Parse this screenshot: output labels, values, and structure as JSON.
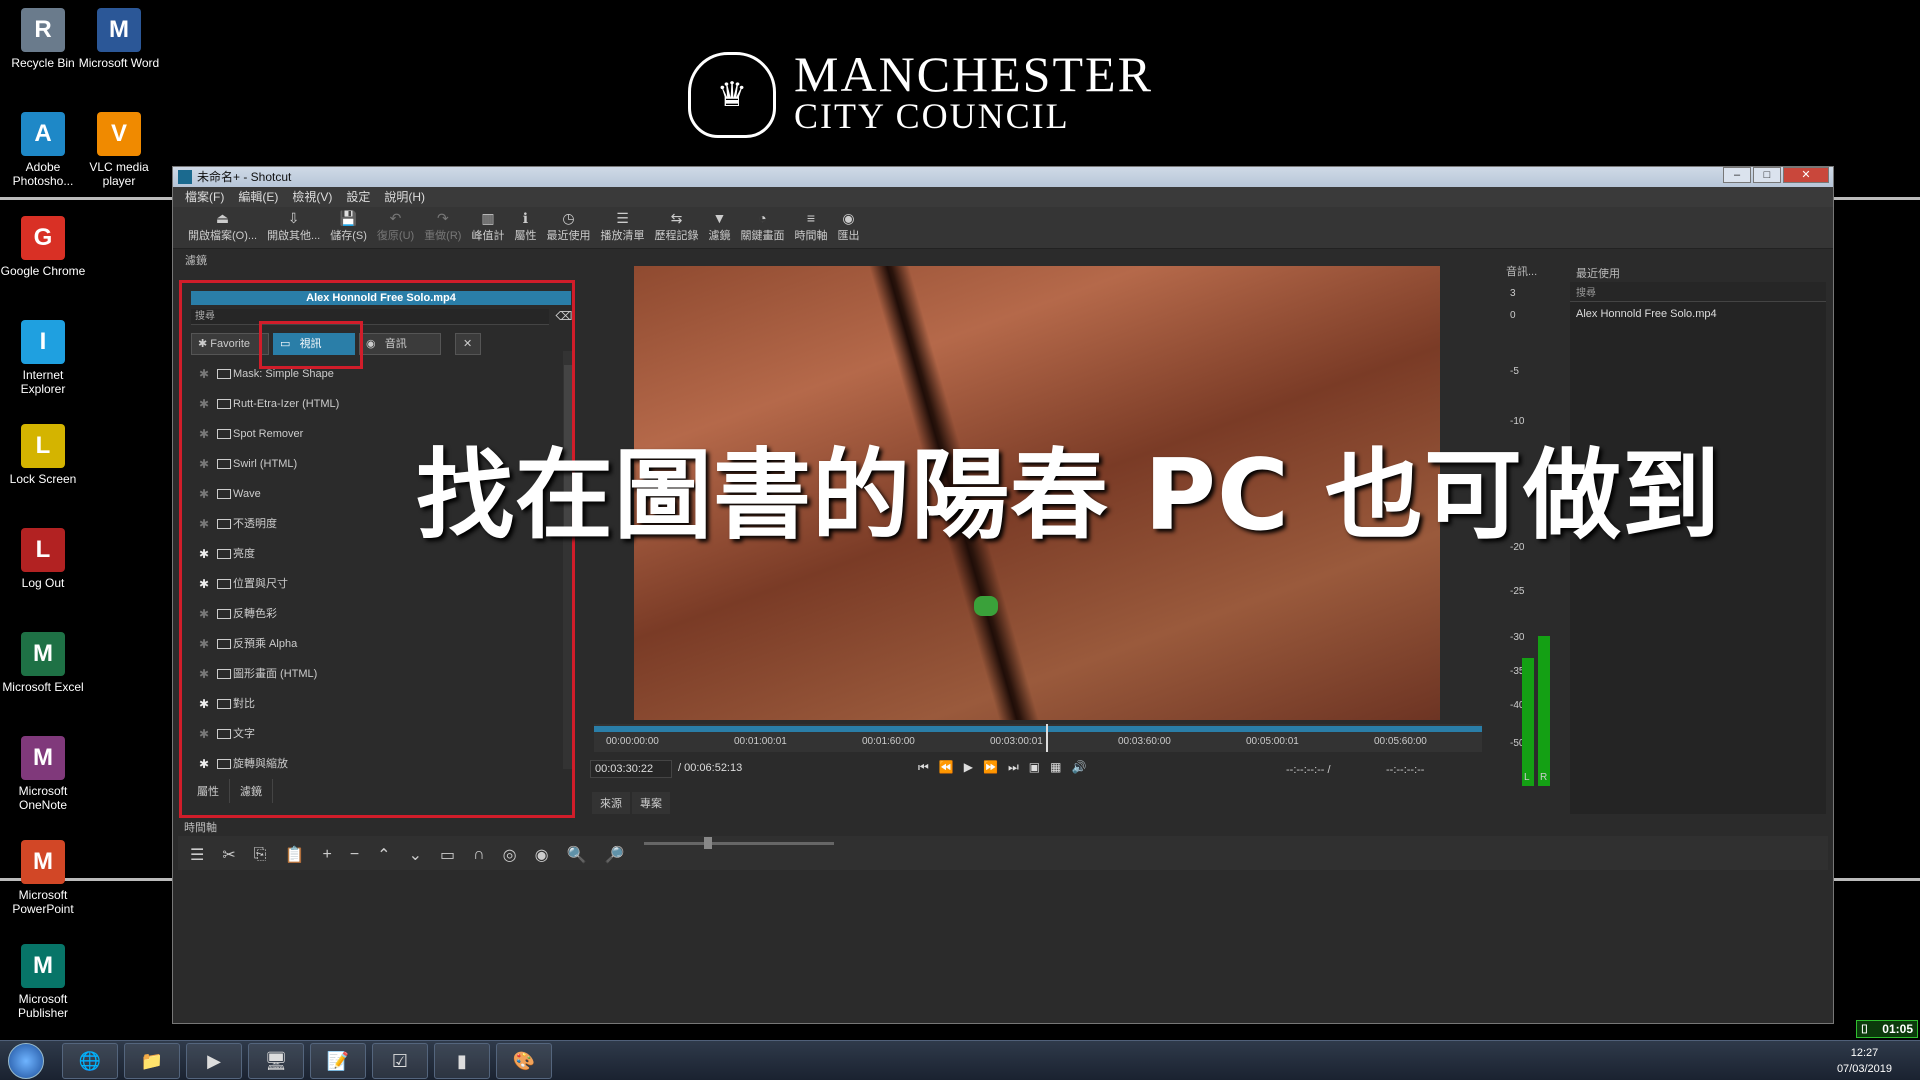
{
  "desktop": {
    "icons": [
      {
        "label": "Recycle Bin",
        "icon": "recycle-bin-icon",
        "color": "#6a7b8c"
      },
      {
        "label": "Microsoft Word",
        "icon": "word-icon",
        "color": "#2b5797"
      },
      {
        "label": "Adobe Photosho...",
        "icon": "photoshop-icon",
        "color": "#1e88c7"
      },
      {
        "label": "VLC media player",
        "icon": "vlc-icon",
        "color": "#f08a00"
      },
      {
        "label": "Google Chrome",
        "icon": "chrome-icon",
        "color": "#d93025"
      },
      {
        "label": "Internet Explorer",
        "icon": "ie-icon",
        "color": "#1fa0e0"
      },
      {
        "label": "Lock Screen",
        "icon": "lock-icon",
        "color": "#d4b400"
      },
      {
        "label": "Log Out",
        "icon": "logout-icon",
        "color": "#b22222"
      },
      {
        "label": "Microsoft Excel",
        "icon": "excel-icon",
        "color": "#1e7145"
      },
      {
        "label": "Microsoft OneNote",
        "icon": "onenote-icon",
        "color": "#80397b"
      },
      {
        "label": "Microsoft PowerPoint",
        "icon": "powerpoint-icon",
        "color": "#d24726"
      },
      {
        "label": "Microsoft Publisher",
        "icon": "publisher-icon",
        "color": "#077568"
      }
    ]
  },
  "logo": {
    "line1": "MANCHESTER",
    "line2": "CITY COUNCIL"
  },
  "window": {
    "title": "未命名+ - Shotcut",
    "menu": [
      "檔案(F)",
      "編輯(E)",
      "檢視(V)",
      "設定",
      "說明(H)"
    ],
    "toolbar": [
      {
        "label": "開啟檔案(O)...",
        "glyph": "⏏",
        "enabled": true
      },
      {
        "label": "開啟其他...",
        "glyph": "⇩",
        "enabled": true
      },
      {
        "label": "儲存(S)",
        "glyph": "💾",
        "enabled": true
      },
      {
        "label": "復原(U)",
        "glyph": "↶",
        "enabled": false
      },
      {
        "label": "重做(R)",
        "glyph": "↷",
        "enabled": false
      },
      {
        "label": "峰值計",
        "glyph": "▥",
        "enabled": true
      },
      {
        "label": "屬性",
        "glyph": "ℹ",
        "enabled": true
      },
      {
        "label": "最近使用",
        "glyph": "◷",
        "enabled": true
      },
      {
        "label": "播放清單",
        "glyph": "☰",
        "enabled": true
      },
      {
        "label": "歷程記錄",
        "glyph": "⇆",
        "enabled": true
      },
      {
        "label": "濾鏡",
        "glyph": "▼",
        "enabled": true
      },
      {
        "label": "關鍵畫面",
        "glyph": "◔",
        "enabled": true
      },
      {
        "label": "時間軸",
        "glyph": "≡",
        "enabled": true
      },
      {
        "label": "匯出",
        "glyph": "◉",
        "enabled": true
      }
    ]
  },
  "filters": {
    "panel_title": "濾鏡",
    "clip_name": "Alex Honnold Free Solo.mp4",
    "search_placeholder": "搜尋",
    "tab_favorite": "Favorite",
    "tab_video": "視訊",
    "tab_audio": "音訊",
    "items": [
      {
        "label": "Mask: Simple Shape",
        "fav": false
      },
      {
        "label": "Rutt-Etra-Izer (HTML)",
        "fav": false
      },
      {
        "label": "Spot Remover",
        "fav": false
      },
      {
        "label": "Swirl (HTML)",
        "fav": false
      },
      {
        "label": "Wave",
        "fav": false
      },
      {
        "label": "不透明度",
        "fav": false
      },
      {
        "label": "亮度",
        "fav": true
      },
      {
        "label": "位置與尺寸",
        "fav": true
      },
      {
        "label": "反轉色彩",
        "fav": false
      },
      {
        "label": "反預乘 Alpha",
        "fav": false
      },
      {
        "label": "圖形畫面 (HTML)",
        "fav": false
      },
      {
        "label": "對比",
        "fav": true
      },
      {
        "label": "文字",
        "fav": false
      },
      {
        "label": "旋轉與縮放",
        "fav": true
      }
    ],
    "bottom_tabs": [
      "屬性",
      "濾鏡"
    ]
  },
  "overlay_text": "找在圖書的陽春 PC 也可做到",
  "player": {
    "ruler_ticks": [
      "00:00:00:00",
      "00:01:00:01",
      "00:01:60:00",
      "00:03:00:01",
      "00:03:60:00",
      "00:05:00:01",
      "00:05:60:00"
    ],
    "position_timecode": "00:03:30:22",
    "duration": "/ 00:06:52:13",
    "in_point": "--:--:--:-- /",
    "out_point": "--:--:--:--",
    "source_tabs": [
      "來源",
      "專案"
    ],
    "controls": [
      "⏮",
      "⏪",
      "▶",
      "⏩",
      "⏭",
      "▣",
      "▦",
      "🔊"
    ]
  },
  "audio_meter": {
    "title": "音訊...",
    "scale": [
      "3",
      "0",
      "-5",
      "-10",
      "-20",
      "-25",
      "-30",
      "-35",
      "-40",
      "-50"
    ],
    "channels": [
      "L",
      "R"
    ],
    "left_level": 0.4,
    "right_level": 0.47
  },
  "recent": {
    "title": "最近使用",
    "search_placeholder": "搜尋",
    "items": [
      "Alex Honnold Free Solo.mp4"
    ]
  },
  "timeline": {
    "title": "時間軸",
    "tools": [
      "☰",
      "✂",
      "⎘",
      "📋",
      "+",
      "−",
      "⌃",
      "⌄",
      "▭",
      "∩",
      "◎",
      "◉",
      "🔍",
      "🔎"
    ]
  },
  "taskbar": {
    "time": "12:27",
    "date": "07/03/2019",
    "timer": "01:05",
    "apps": [
      "🌐",
      "📁",
      "▶",
      "🖥",
      "📝",
      "☑",
      "▮",
      "🎨"
    ]
  }
}
